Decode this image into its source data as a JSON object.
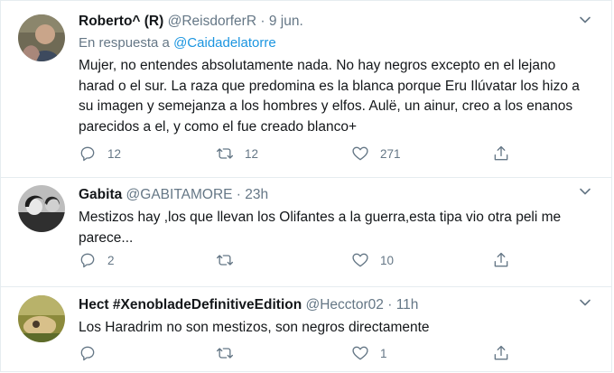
{
  "tweets": [
    {
      "name": "Roberto^ (R)",
      "handle": "@ReisdorferR",
      "separator": "·",
      "time": "9 jun.",
      "reply_prefix": "En respuesta a",
      "reply_mention": "@Caidadelatorre",
      "text": "Mujer, no entendes absolutamente nada. No hay negros excepto en el lejano harad o el sur. La raza que predomina es la blanca porque Eru Ilúvatar los hizo a su imagen y semejanza a los hombres y elfos. Aulë, un ainur, creo a los enanos parecidos a el, y como el fue creado blanco+",
      "replies": "12",
      "retweets": "12",
      "likes": "271"
    },
    {
      "name": "Gabita",
      "handle": "@GABITAMORE",
      "separator": "·",
      "time": "23h",
      "text": "Mestizos hay ,los que llevan los Olifantes a la guerra,esta tipa vio otra peli me parece...",
      "replies": "2",
      "retweets": "",
      "likes": "10"
    },
    {
      "name": "Hect #XenobladeDefinitiveEdition",
      "handle": "@Hecctor02",
      "separator": "·",
      "time": "11h",
      "text": "Los Haradrim no son mestizos, son negros directamente",
      "replies": "",
      "retweets": "",
      "likes": "1"
    }
  ],
  "colors": {
    "text": "#14171a",
    "secondary": "#657786",
    "link": "#1b95e0",
    "border": "#e6ecf0"
  },
  "icons": [
    "reply-icon",
    "retweet-icon",
    "like-icon",
    "share-icon",
    "chevron-down-icon"
  ]
}
